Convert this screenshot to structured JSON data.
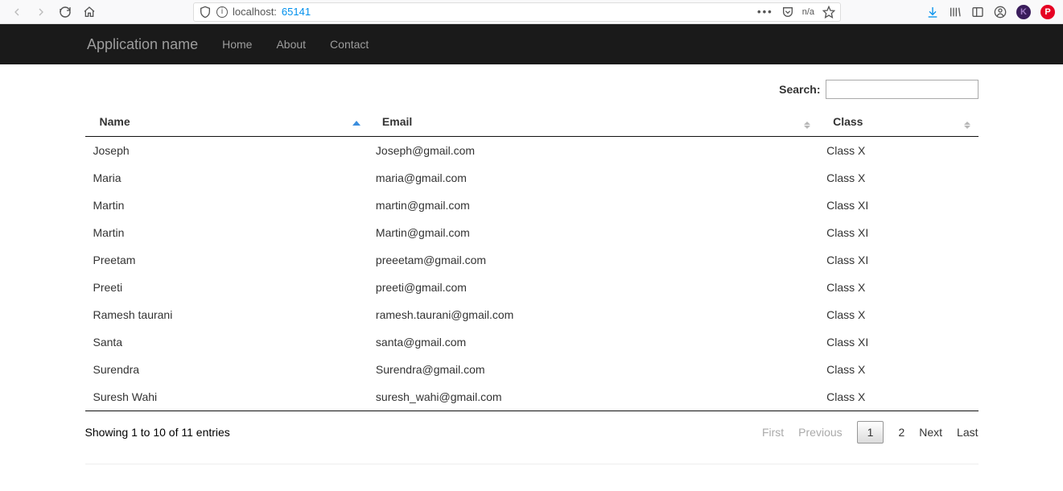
{
  "browser": {
    "url_host": "localhost:",
    "url_port": "65141",
    "reader_label": "n/a"
  },
  "navbar": {
    "brand": "Application name",
    "links": [
      "Home",
      "About",
      "Contact"
    ]
  },
  "search": {
    "label": "Search:",
    "value": ""
  },
  "table": {
    "headers": {
      "name": "Name",
      "email": "Email",
      "class": "Class"
    },
    "rows": [
      {
        "name": "Joseph",
        "email": "Joseph@gmail.com",
        "class": "Class X"
      },
      {
        "name": "Maria",
        "email": "maria@gmail.com",
        "class": "Class X"
      },
      {
        "name": "Martin",
        "email": "martin@gmail.com",
        "class": "Class XI"
      },
      {
        "name": "Martin",
        "email": "Martin@gmail.com",
        "class": "Class XI"
      },
      {
        "name": "Preetam",
        "email": "preeetam@gmail.com",
        "class": "Class XI"
      },
      {
        "name": "Preeti",
        "email": "preeti@gmail.com",
        "class": "Class X"
      },
      {
        "name": "Ramesh taurani",
        "email": "ramesh.taurani@gmail.com",
        "class": "Class X"
      },
      {
        "name": "Santa",
        "email": "santa@gmail.com",
        "class": "Class XI"
      },
      {
        "name": "Surendra",
        "email": "Surendra@gmail.com",
        "class": "Class X"
      },
      {
        "name": "Suresh Wahi",
        "email": "suresh_wahi@gmail.com",
        "class": "Class X"
      }
    ]
  },
  "footer": {
    "info": "Showing 1 to 10 of 11 entries",
    "pagination": {
      "first": "First",
      "previous": "Previous",
      "pages": [
        "1",
        "2"
      ],
      "current": "1",
      "next": "Next",
      "last": "Last"
    }
  }
}
